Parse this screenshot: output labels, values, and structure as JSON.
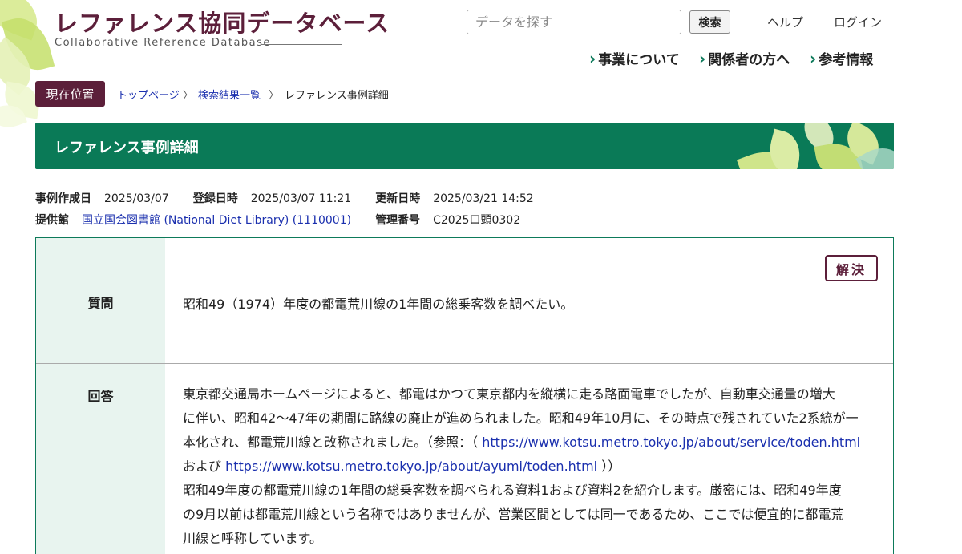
{
  "header": {
    "logo_title": "レファレンス協同データベース",
    "logo_subtitle": "Collaborative Reference Database",
    "search_placeholder": "データを探す",
    "search_button": "検索",
    "help_link": "ヘルプ",
    "login_link": "ログイン"
  },
  "nav": {
    "items": [
      {
        "label": "事業について"
      },
      {
        "label": "関係者の方へ"
      },
      {
        "label": "参考情報"
      }
    ]
  },
  "breadcrumb": {
    "badge": "現在位置",
    "items": [
      "トップページ",
      "検索結果一覧",
      "レファレンス事例詳細"
    ]
  },
  "page": {
    "title": "レファレンス事例詳細"
  },
  "meta": {
    "created_label": "事例作成日",
    "created_value": "2025/03/07",
    "registered_label": "登録日時",
    "registered_value": "2025/03/07 11:21",
    "updated_label": "更新日時",
    "updated_value": "2025/03/21 14:52",
    "library_label": "提供館",
    "library_value": "国立国会図書館 (National Diet Library) (1110001)",
    "control_label": "管理番号",
    "control_value": "C2025口頭0302"
  },
  "record": {
    "status_badge": "解決",
    "question_label": "質問",
    "question_text": "昭和49（1974）年度の都電荒川線の1年間の総乗客数を調べたい。",
    "answer_label": "回答",
    "answer_lines": {
      "l1": "東京都交通局ホームページによると、都電はかつて東京都内を縦横に走る路面電車でしたが、自動車交通量の増大",
      "l2": "に伴い、昭和42～47年の期間に路線の廃止が進められました。昭和49年10月に、その時点で残されていた2系統が一",
      "l3_text": "本化され、都電荒川線と改称されました。（参照：（ ",
      "l3_link": "https://www.kotsu.metro.tokyo.jp/about/service/toden.html",
      "l4_text": "および ",
      "l4_link": "https://www.kotsu.metro.tokyo.jp/about/ayumi/toden.html",
      "l4_tail": " ））",
      "l5": "昭和49年度の都電荒川線の1年間の総乗客数を調べられる資料1および資料2を紹介します。厳密には、昭和49年度",
      "l6": "の9月以前は都電荒川線という名称ではありませんが、営業区間としては同一であるため、ここでは便宜的に都電荒",
      "l7": "川線と呼称しています。"
    }
  },
  "colors": {
    "brand_maroon": "#5c1f3a",
    "brand_green": "#0a7a57",
    "link_blue": "#1a2fae",
    "panel_left_bg": "#e8f4ef"
  }
}
